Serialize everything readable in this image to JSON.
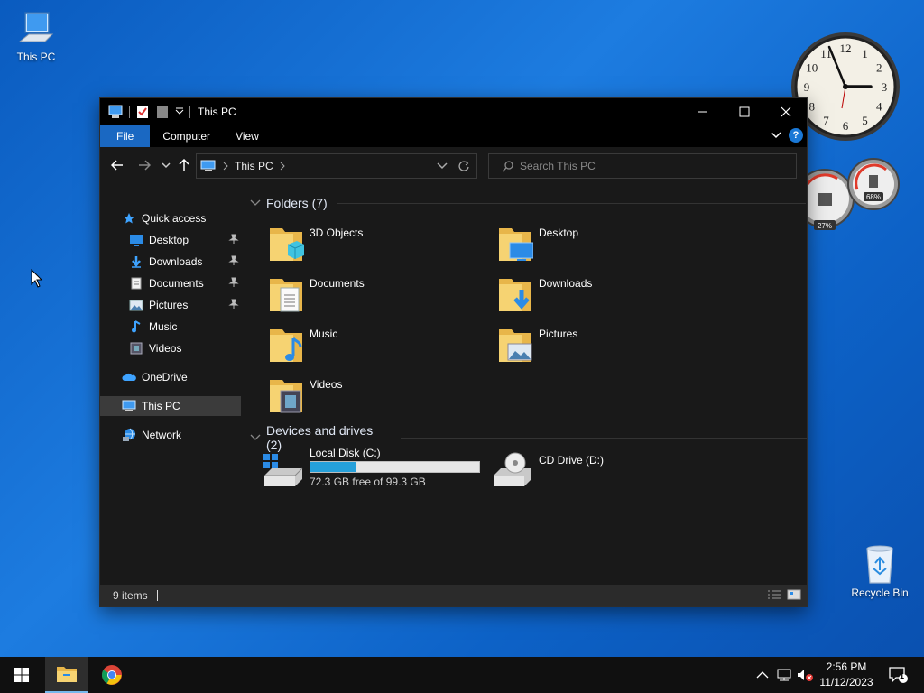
{
  "desktop": {
    "icons": [
      {
        "label": "This PC",
        "icon": "computer-icon"
      },
      {
        "label": "Recycle Bin",
        "icon": "recycle-bin-icon"
      }
    ],
    "gadgets": {
      "clock": {
        "numerals": [
          "12",
          "1",
          "2",
          "3",
          "4",
          "5",
          "6",
          "7",
          "8",
          "9",
          "10",
          "11"
        ],
        "time": "2:56"
      },
      "meter": {
        "cpu": "27%",
        "memory": "68%"
      }
    }
  },
  "window": {
    "title": "This PC",
    "ribbon_tabs": [
      "File",
      "Computer",
      "View"
    ],
    "address_path": "This PC",
    "search_placeholder": "Search This PC",
    "accent": "#1a68c2",
    "sidebar": {
      "quick_access": "Quick access",
      "pinned": [
        "Desktop",
        "Downloads",
        "Documents",
        "Pictures"
      ],
      "others": [
        "Music",
        "Videos"
      ],
      "onedrive": "OneDrive",
      "thispc": "This PC",
      "network": "Network"
    },
    "folders_header": "Folders (7)",
    "folders": [
      "3D Objects",
      "Desktop",
      "Documents",
      "Downloads",
      "Music",
      "Pictures",
      "Videos"
    ],
    "drives_header": "Devices and drives (2)",
    "drives": [
      {
        "name": "Local Disk (C:)",
        "free_text": "72.3 GB free of 99.3 GB",
        "used_fraction": 0.27
      },
      {
        "name": "CD Drive (D:)"
      }
    ],
    "status": {
      "items": "9 items"
    }
  },
  "taskbar": {
    "time": "2:56 PM",
    "date": "11/12/2023",
    "notification_count": "1",
    "apps": [
      "start-icon",
      "file-explorer-icon",
      "chrome-icon"
    ]
  }
}
